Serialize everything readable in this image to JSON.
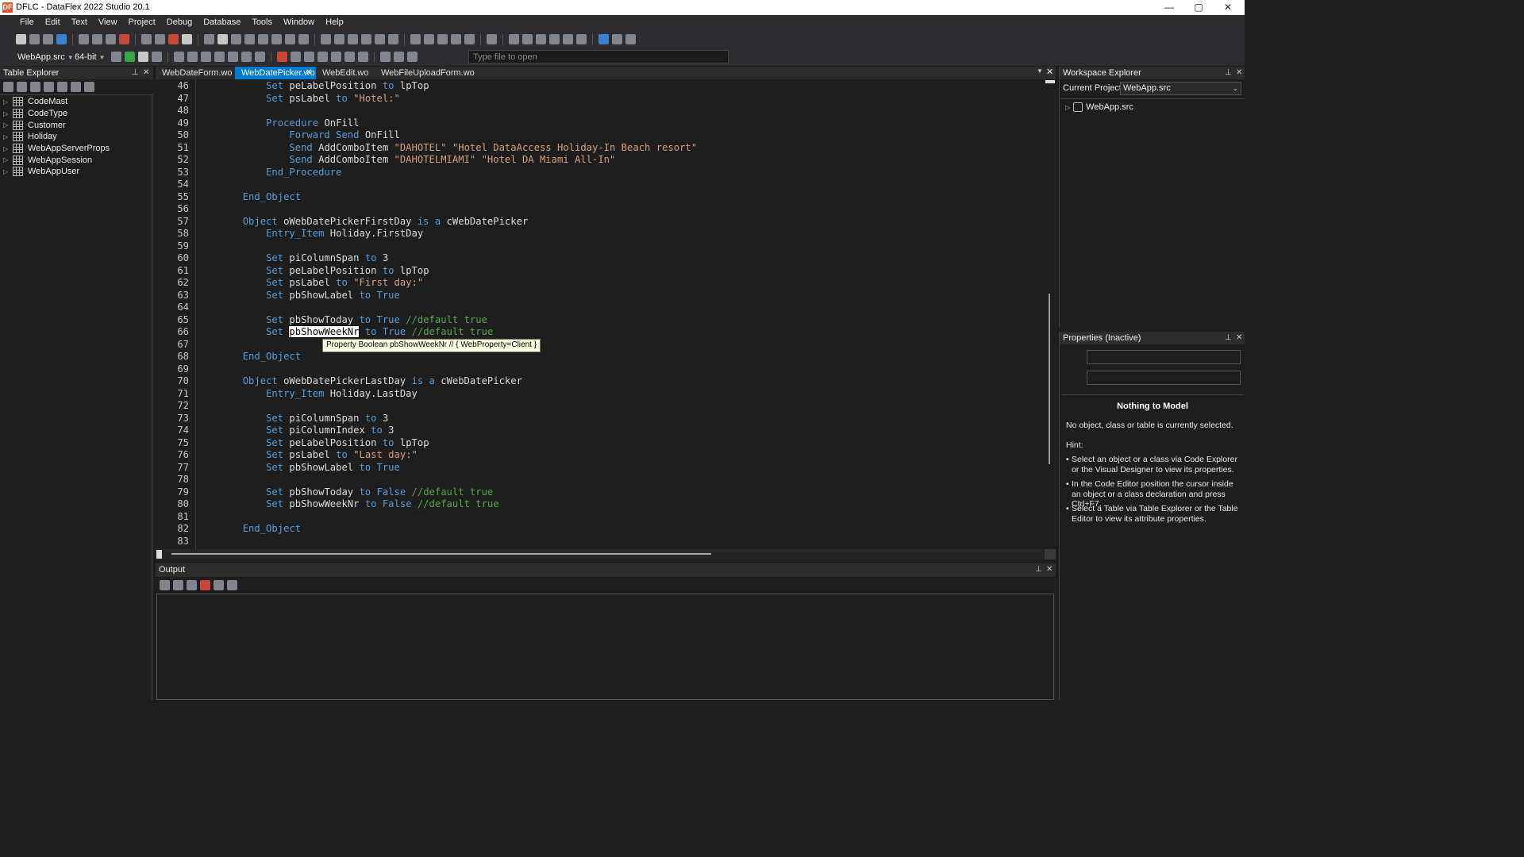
{
  "window": {
    "title": "DFLC - DataFlex 2022 Studio 20.1",
    "app_icon": "DF",
    "controls": {
      "minimize": "—",
      "maximize": "▢",
      "close": "✕"
    }
  },
  "menu": [
    "File",
    "Edit",
    "Text",
    "View",
    "Project",
    "Debug",
    "Database",
    "Tools",
    "Window",
    "Help"
  ],
  "toolbar": {
    "project_select": "WebApp.src",
    "bitness_select": "64-bit",
    "file_open_placeholder": "Type file to open"
  },
  "table_explorer": {
    "title": "Table Explorer",
    "tables": [
      "CodeMast",
      "CodeType",
      "Customer",
      "Holiday",
      "WebAppServerProps",
      "WebAppSession",
      "WebAppUser"
    ]
  },
  "tabs": [
    {
      "label": "WebDateForm.wo",
      "active": false
    },
    {
      "label": "WebDatePicker.wo",
      "active": true
    },
    {
      "label": "WebEdit.wo",
      "active": false
    },
    {
      "label": "WebFileUploadForm.wo",
      "active": false
    }
  ],
  "editor": {
    "lines": [
      {
        "n": "46",
        "html": "            <span class='kw'>Set</span> peLabelPosition <span class='kw'>to</span> lpTop"
      },
      {
        "n": "47",
        "html": "            <span class='kw'>Set</span> psLabel <span class='kw'>to</span> <span class='str'>\"Hotel:\"</span>"
      },
      {
        "n": "48",
        "html": ""
      },
      {
        "n": "49",
        "html": "            <span class='kw'>Procedure</span> OnFill"
      },
      {
        "n": "50",
        "html": "                <span class='kw'>Forward</span> <span class='kw'>Send</span> OnFill"
      },
      {
        "n": "51",
        "html": "                <span class='kw'>Send</span> AddComboItem <span class='str'>\"DAHOTEL\"</span> <span class='str'>\"Hotel DataAccess Holiday-In Beach resort\"</span>"
      },
      {
        "n": "52",
        "html": "                <span class='kw'>Send</span> AddComboItem <span class='str'>\"DAHOTELMIAMI\"</span> <span class='str'>\"Hotel DA Miami All-In\"</span>"
      },
      {
        "n": "53",
        "html": "            <span class='kw'>End_Procedure</span>"
      },
      {
        "n": "54",
        "html": ""
      },
      {
        "n": "55",
        "html": "        <span class='kw'>End_Object</span>"
      },
      {
        "n": "56",
        "html": ""
      },
      {
        "n": "57",
        "html": "        <span class='kw'>Object</span> oWebDatePickerFirstDay <span class='kw'>is</span> <span class='kw'>a</span> cWebDatePicker"
      },
      {
        "n": "58",
        "html": "            <span class='kw'>Entry_Item</span> Holiday.FirstDay"
      },
      {
        "n": "59",
        "html": ""
      },
      {
        "n": "60",
        "html": "            <span class='kw'>Set</span> piColumnSpan <span class='kw'>to</span> 3"
      },
      {
        "n": "61",
        "html": "            <span class='kw'>Set</span> peLabelPosition <span class='kw'>to</span> lpTop"
      },
      {
        "n": "62",
        "html": "            <span class='kw'>Set</span> psLabel <span class='kw'>to</span> <span class='str'>\"First day:\"</span>"
      },
      {
        "n": "63",
        "html": "            <span class='kw'>Set</span> pbShowLabel <span class='kw'>to</span> <span class='kw'>True</span>"
      },
      {
        "n": "64",
        "html": ""
      },
      {
        "n": "65",
        "html": "            <span class='kw'>Set</span> pbShowToday <span class='kw'>to</span> <span class='kw'>True</span> <span class='cm'>//default true</span>"
      },
      {
        "n": "66",
        "html": "            <span class='kw'>Set</span> <span class='sel'>pbShowWeekNr</span> <span class='kw'>to</span> <span class='kw'>True</span> <span class='cm'>//default true</span>"
      },
      {
        "n": "67",
        "html": ""
      },
      {
        "n": "68",
        "html": "        <span class='kw'>End_Object</span>"
      },
      {
        "n": "69",
        "html": ""
      },
      {
        "n": "70",
        "html": "        <span class='kw'>Object</span> oWebDatePickerLastDay <span class='kw'>is</span> <span class='kw'>a</span> cWebDatePicker"
      },
      {
        "n": "71",
        "html": "            <span class='kw'>Entry_Item</span> Holiday.LastDay"
      },
      {
        "n": "72",
        "html": ""
      },
      {
        "n": "73",
        "html": "            <span class='kw'>Set</span> piColumnSpan <span class='kw'>to</span> 3"
      },
      {
        "n": "74",
        "html": "            <span class='kw'>Set</span> piColumnIndex <span class='kw'>to</span> 3"
      },
      {
        "n": "75",
        "html": "            <span class='kw'>Set</span> peLabelPosition <span class='kw'>to</span> lpTop"
      },
      {
        "n": "76",
        "html": "            <span class='kw'>Set</span> psLabel <span class='kw'>to</span> <span class='str'>\"Last day:\"</span>"
      },
      {
        "n": "77",
        "html": "            <span class='kw'>Set</span> pbShowLabel <span class='kw'>to</span> <span class='kw'>True</span>"
      },
      {
        "n": "78",
        "html": ""
      },
      {
        "n": "79",
        "html": "            <span class='kw'>Set</span> pbShowToday <span class='kw'>to</span> <span class='kw'>False</span> <span class='cm'>//default true</span>"
      },
      {
        "n": "80",
        "html": "            <span class='kw'>Set</span> pbShowWeekNr <span class='kw'>to</span> <span class='kw'>False</span> <span class='cm'>//default true</span>"
      },
      {
        "n": "81",
        "html": ""
      },
      {
        "n": "82",
        "html": "        <span class='kw'>End_Object</span>"
      },
      {
        "n": "83",
        "html": ""
      }
    ],
    "tooltip": "Property Boolean pbShowWeekNr // { WebProperty=Client }"
  },
  "output": {
    "title": "Output"
  },
  "workspace": {
    "title": "Workspace Explorer",
    "current_project_label": "Current Project:",
    "current_project_value": "WebApp.src",
    "tree_root": "WebApp.src"
  },
  "properties": {
    "title": "Properties (Inactive)",
    "heading": "Nothing to Model",
    "message": "No object, class or table is currently selected.",
    "hint_label": "Hint:",
    "hints": [
      "Select an object or a class via Code Explorer or the Visual Designer to view its properties.",
      "In the Code Editor position the cursor inside an object or a class declaration and press Ctrl+F7.",
      "Select a Table via Table Explorer or the Table Editor to view its attribute properties."
    ]
  },
  "colors": {
    "accent": "#007acc",
    "keyword": "#569cd6",
    "string": "#d69d85",
    "comment": "#57a64a",
    "background": "#1e1e1e"
  }
}
